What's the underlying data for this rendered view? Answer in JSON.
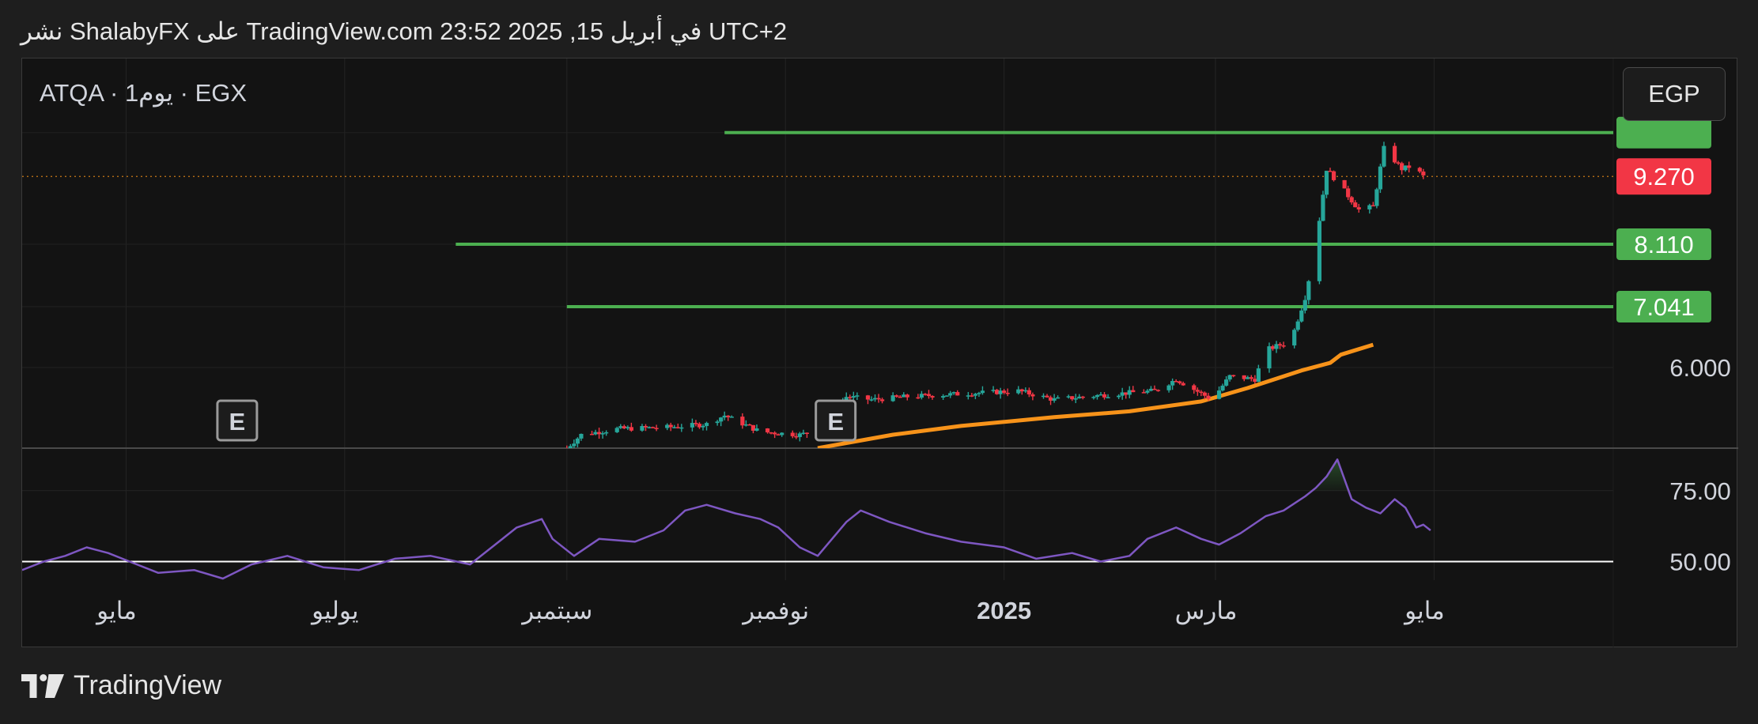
{
  "header": {
    "publish_line": "نشر ShalabyFX على TradingView.com في أبريل 15, 2025 23:52 UTC+2"
  },
  "legend": {
    "symbol_line": "ATQA · 1يوم · EGX"
  },
  "currency": {
    "label": "EGP"
  },
  "footer": {
    "brand": "TradingView"
  },
  "colors": {
    "up": "#26a69a",
    "down": "#f23645",
    "level_line": "#4caf50",
    "moving_average": "#f7931a",
    "rsi_line": "#7e57c2",
    "last_price": "#f23645"
  },
  "chart_data": [
    {
      "type": "candlestick",
      "title": "ATQA · 1يوم · EGX",
      "currency": "EGP",
      "x_ticks": [
        {
          "label": "مايو",
          "date": "2024-05-01",
          "bold": false
        },
        {
          "label": "يوليو",
          "date": "2024-07-01",
          "bold": false
        },
        {
          "label": "سبتمبر",
          "date": "2024-09-01",
          "bold": false
        },
        {
          "label": "نوفمبر",
          "date": "2024-11-01",
          "bold": false
        },
        {
          "label": "2025",
          "date": "2025-01-01",
          "bold": true
        },
        {
          "label": "مارس",
          "date": "2025-03-01",
          "bold": false
        },
        {
          "label": "مايو",
          "date": "2025-05-01",
          "bold": false
        }
      ],
      "x_range": [
        "2024-04-02",
        "2025-06-20"
      ],
      "y_range": [
        4.62,
        10.45
      ],
      "y_ticks": [
        {
          "value": 6.0,
          "label": "6.000"
        }
      ],
      "last_price": {
        "value": 9.27,
        "label": "9.270"
      },
      "levels": [
        {
          "value": 10.02,
          "start": "2024-10-15",
          "label": ""
        },
        {
          "value": 8.11,
          "start": "2024-08-01",
          "label": "8.110"
        },
        {
          "value": 7.041,
          "start": "2024-09-01",
          "label": "7.041"
        }
      ],
      "earnings_markers": [
        {
          "date": "2024-06-01",
          "label": "E"
        },
        {
          "date": "2024-11-15",
          "label": "E"
        }
      ],
      "moving_average": [
        [
          "2024-11-10",
          4.62
        ],
        [
          "2024-12-01",
          4.85
        ],
        [
          "2024-12-20",
          5.0
        ],
        [
          "2025-01-15",
          5.15
        ],
        [
          "2025-02-05",
          5.25
        ],
        [
          "2025-02-25",
          5.42
        ],
        [
          "2025-03-10",
          5.65
        ],
        [
          "2025-03-25",
          5.95
        ],
        [
          "2025-04-02",
          6.08
        ],
        [
          "2025-04-05",
          6.22
        ],
        [
          "2025-04-14",
          6.39
        ]
      ],
      "ohlc_anchors": [
        [
          "2024-09-01",
          4.62
        ],
        [
          "2024-09-05",
          4.85
        ],
        [
          "2024-09-15",
          4.95
        ],
        [
          "2024-09-30",
          4.98
        ],
        [
          "2024-10-10",
          5.03
        ],
        [
          "2024-10-15",
          5.18
        ],
        [
          "2024-10-25",
          4.9
        ],
        [
          "2024-11-05",
          4.85
        ],
        [
          "2024-11-12",
          4.95
        ],
        [
          "2024-11-18",
          5.5
        ],
        [
          "2024-11-25",
          5.45
        ],
        [
          "2024-12-05",
          5.5
        ],
        [
          "2024-12-20",
          5.55
        ],
        [
          "2025-01-05",
          5.6
        ],
        [
          "2025-01-15",
          5.45
        ],
        [
          "2025-02-01",
          5.55
        ],
        [
          "2025-02-12",
          5.6
        ],
        [
          "2025-02-18",
          5.8
        ],
        [
          "2025-02-28",
          5.45
        ],
        [
          "2025-03-05",
          5.85
        ],
        [
          "2025-03-12",
          5.8
        ],
        [
          "2025-03-15",
          6.3
        ],
        [
          "2025-03-22",
          6.45
        ],
        [
          "2025-03-26",
          7.2
        ],
        [
          "2025-03-29",
          8.1
        ],
        [
          "2025-04-01",
          9.4
        ],
        [
          "2025-04-05",
          9.1
        ],
        [
          "2025-04-10",
          8.7
        ],
        [
          "2025-04-14",
          8.75
        ],
        [
          "2025-04-17",
          9.75
        ],
        [
          "2025-04-22",
          9.4
        ],
        [
          "2025-04-25",
          9.45
        ],
        [
          "2025-04-28",
          9.27
        ]
      ]
    },
    {
      "type": "line",
      "title": "",
      "y_range": [
        44.0,
        90.0
      ],
      "y_ticks": [
        {
          "value": 75.0,
          "label": "75.00"
        },
        {
          "value": 50.0,
          "label": "50.00"
        }
      ],
      "reference_line": 50.0,
      "series": [
        {
          "values": [
            [
              "2024-04-02",
              47
            ],
            [
              "2024-04-08",
              50
            ],
            [
              "2024-04-14",
              52
            ],
            [
              "2024-04-20",
              55
            ],
            [
              "2024-04-26",
              53
            ],
            [
              "2024-05-02",
              50
            ],
            [
              "2024-05-10",
              46
            ],
            [
              "2024-05-20",
              47
            ],
            [
              "2024-05-28",
              44
            ],
            [
              "2024-06-05",
              49
            ],
            [
              "2024-06-15",
              52
            ],
            [
              "2024-06-25",
              48
            ],
            [
              "2024-07-05",
              47
            ],
            [
              "2024-07-15",
              51
            ],
            [
              "2024-07-25",
              52
            ],
            [
              "2024-08-05",
              49
            ],
            [
              "2024-08-12",
              56
            ],
            [
              "2024-08-18",
              62
            ],
            [
              "2024-08-25",
              65
            ],
            [
              "2024-08-28",
              58
            ],
            [
              "2024-09-03",
              52
            ],
            [
              "2024-09-10",
              58
            ],
            [
              "2024-09-20",
              57
            ],
            [
              "2024-09-28",
              61
            ],
            [
              "2024-10-04",
              68
            ],
            [
              "2024-10-10",
              70
            ],
            [
              "2024-10-18",
              67
            ],
            [
              "2024-10-25",
              65
            ],
            [
              "2024-10-30",
              62
            ],
            [
              "2024-11-05",
              55
            ],
            [
              "2024-11-10",
              52
            ],
            [
              "2024-11-18",
              64
            ],
            [
              "2024-11-22",
              68
            ],
            [
              "2024-11-30",
              64
            ],
            [
              "2024-12-10",
              60
            ],
            [
              "2024-12-20",
              57
            ],
            [
              "2025-01-01",
              55
            ],
            [
              "2025-01-10",
              51
            ],
            [
              "2025-01-20",
              53
            ],
            [
              "2025-01-28",
              50
            ],
            [
              "2025-02-05",
              52
            ],
            [
              "2025-02-10",
              58
            ],
            [
              "2025-02-18",
              62
            ],
            [
              "2025-02-25",
              58
            ],
            [
              "2025-03-02",
              56
            ],
            [
              "2025-03-08",
              60
            ],
            [
              "2025-03-15",
              66
            ],
            [
              "2025-03-20",
              68
            ],
            [
              "2025-03-26",
              73
            ],
            [
              "2025-03-29",
              76
            ],
            [
              "2025-04-01",
              80
            ],
            [
              "2025-04-04",
              86
            ],
            [
              "2025-04-08",
              72
            ],
            [
              "2025-04-12",
              69
            ],
            [
              "2025-04-16",
              67
            ],
            [
              "2025-04-20",
              72
            ],
            [
              "2025-04-23",
              69
            ],
            [
              "2025-04-26",
              62
            ],
            [
              "2025-04-28",
              63
            ],
            [
              "2025-04-30",
              61
            ]
          ]
        }
      ]
    }
  ]
}
